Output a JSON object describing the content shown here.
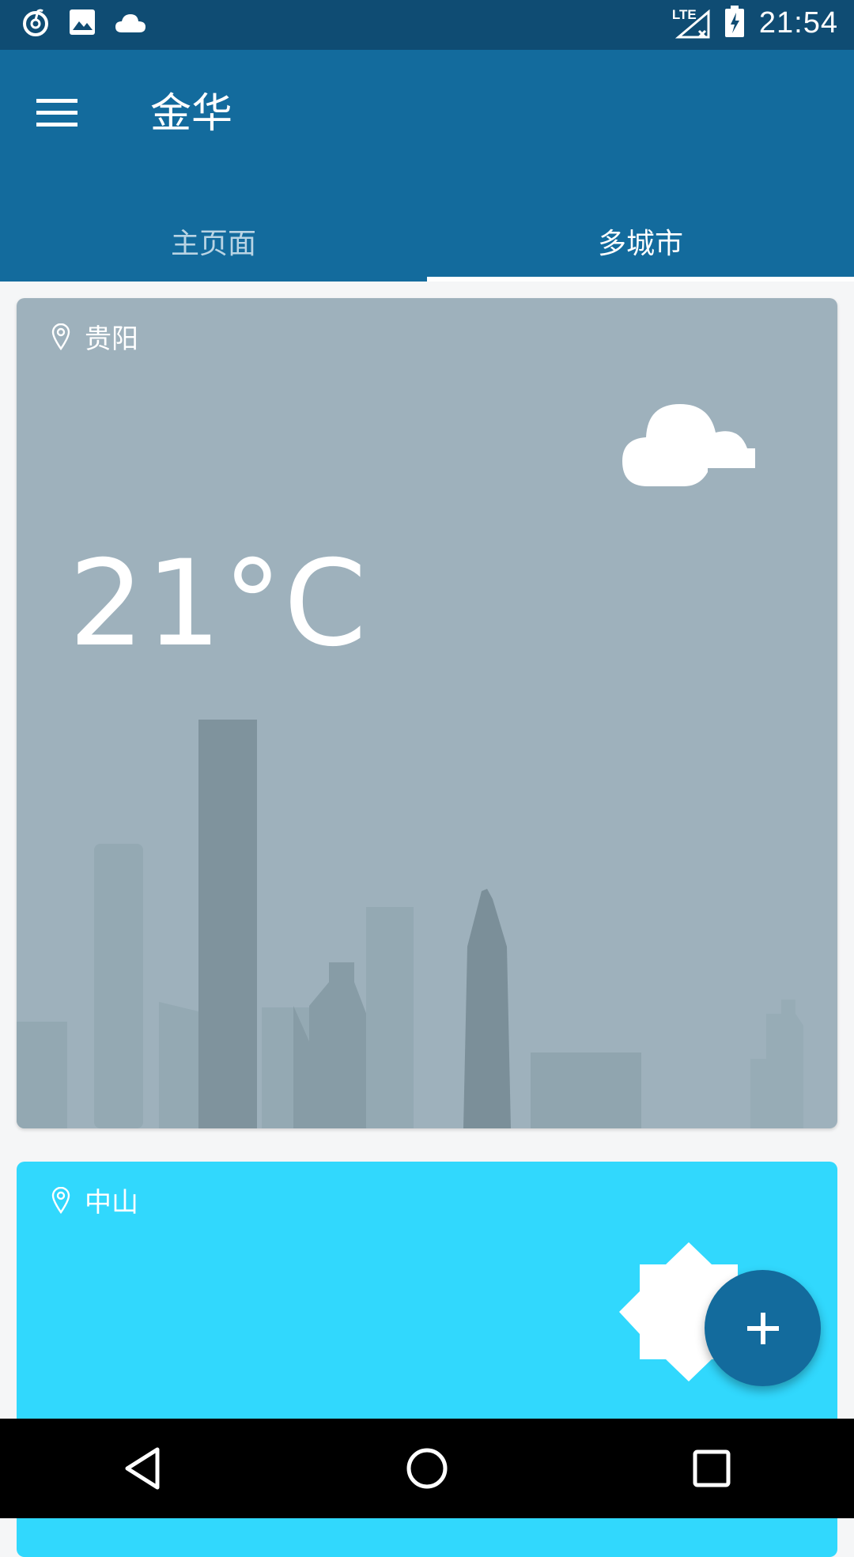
{
  "status_bar": {
    "time": "21:54",
    "network_label": "LTE",
    "icons": [
      "netease-music-icon",
      "image-icon",
      "cloud-icon",
      "signal-icon",
      "battery-charging-icon"
    ]
  },
  "app_bar": {
    "title": "金华",
    "menu_icon": "hamburger-menu-icon"
  },
  "tabs": [
    {
      "label": "主页面",
      "active": false
    },
    {
      "label": "多城市",
      "active": true
    }
  ],
  "cards": [
    {
      "city": "贵阳",
      "temperature": "21°C",
      "weather_icon": "cloud-icon",
      "background": "#9eb1bc"
    },
    {
      "city": "中山",
      "weather_icon": "sun-icon",
      "background": "#31d8fd"
    }
  ],
  "fab": {
    "icon": "plus-icon",
    "color": "#136b9d"
  },
  "nav_bar": {
    "icons": [
      "back-icon",
      "home-icon",
      "recents-icon"
    ]
  },
  "colors": {
    "status_bar": "#0f4c73",
    "app_bar": "#136b9d",
    "tab_inactive": "#b9d4e4"
  }
}
